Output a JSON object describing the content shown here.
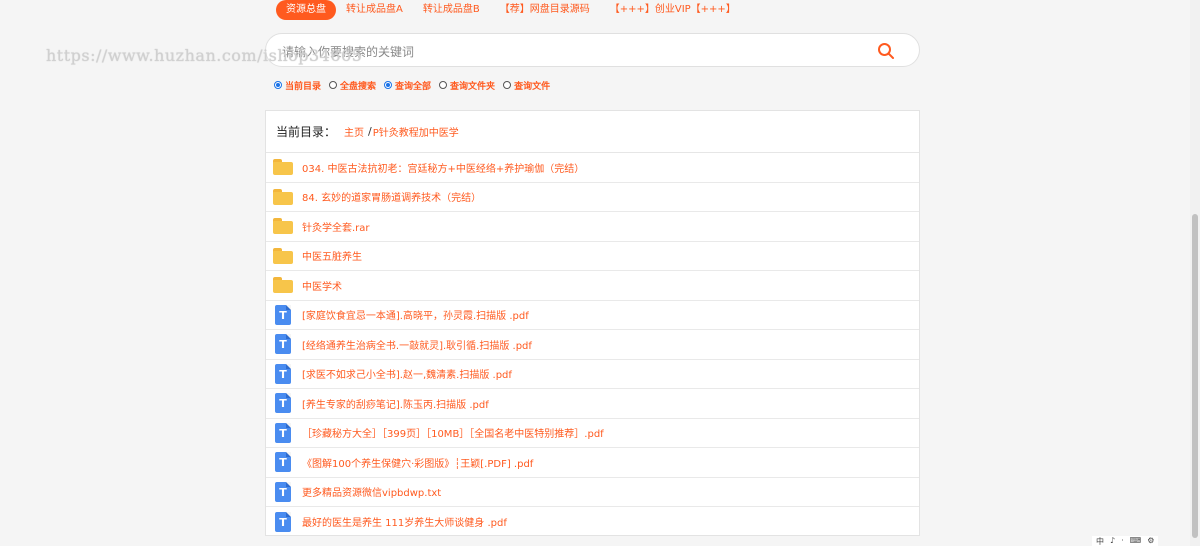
{
  "watermark": "https://www.huzhan.com/ishop34665",
  "nav": {
    "items": [
      {
        "label": "资源总盘",
        "active": true
      },
      {
        "label": "转让成品盘A",
        "active": false
      },
      {
        "label": "转让成品盘B",
        "active": false
      },
      {
        "label": "【荐】网盘目录源码",
        "active": false
      },
      {
        "label": "【+++】创业VIP【+++】",
        "active": false
      }
    ]
  },
  "search": {
    "placeholder": "请输入你要搜索的关键词",
    "value": ""
  },
  "options": [
    {
      "label": "当前目录",
      "checked": true
    },
    {
      "label": "全盘搜索",
      "checked": false
    },
    {
      "label": "查询全部",
      "checked": true
    },
    {
      "label": "查询文件夹",
      "checked": false
    },
    {
      "label": "查询文件",
      "checked": false
    }
  ],
  "breadcrumb": {
    "label": "当前目录：",
    "home": "主页",
    "separator": "/",
    "current": "P针灸教程加中医学"
  },
  "files": [
    {
      "type": "folder",
      "name": "034. 中医古法抗初老：宫廷秘方+中医经络+养护瑜伽（完结）"
    },
    {
      "type": "folder",
      "name": "84. 玄妙的道家胃肠道调养技术（完结）"
    },
    {
      "type": "folder",
      "name": "针灸学全套.rar"
    },
    {
      "type": "folder",
      "name": "中医五脏养生"
    },
    {
      "type": "folder",
      "name": "中医学术"
    },
    {
      "type": "file",
      "name": "[家庭饮食宜忌一本通].高晓平，孙灵霞.扫描版 .pdf"
    },
    {
      "type": "file",
      "name": "[经络通养生治病全书.一敲就灵].耿引循.扫描版 .pdf"
    },
    {
      "type": "file",
      "name": "[求医不如求己小全书].赵一,魏清素.扫描版 .pdf"
    },
    {
      "type": "file",
      "name": "[养生专家的刮痧笔记].陈玉丙.扫描版 .pdf"
    },
    {
      "type": "file",
      "name": "［珍藏秘方大全］［399页］［10MB］［全国名老中医特别推荐］.pdf"
    },
    {
      "type": "file",
      "name": "《图解100个养生保健穴·彩图版》┆王颖[.PDF] .pdf"
    },
    {
      "type": "file",
      "name": "更多精品资源微信vipbdwp.txt"
    },
    {
      "type": "file",
      "name": "最好的医生是养生 111岁养生大师谈健身 .pdf"
    }
  ],
  "icons": {
    "folder": "folder-icon",
    "file": "document-icon",
    "search": "search-icon"
  },
  "colors": {
    "accent": "#ff5a1f",
    "folder": "#f7c54a",
    "document": "#4a8cf0"
  },
  "tray": [
    "中",
    "♪",
    "·",
    "⌨",
    "⚙"
  ]
}
